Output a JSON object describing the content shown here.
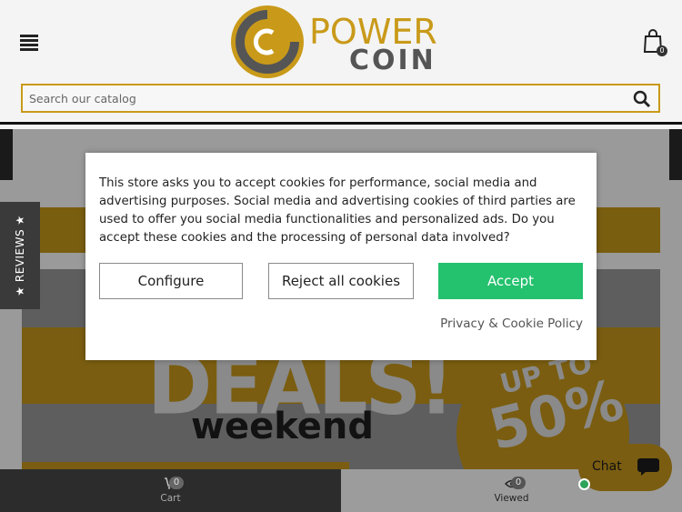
{
  "header": {
    "menu_icon": "hamburger-icon",
    "logo_text_top": "POWER",
    "logo_text_bottom": "COIN",
    "cart_icon": "shopping-bag-icon",
    "cart_count": "0"
  },
  "search": {
    "placeholder": "Search our catalog",
    "icon": "search-icon"
  },
  "reviews_tab": {
    "label": "★ REVIEWS ★"
  },
  "banner": {
    "headline": "DEALS!",
    "subline": "weekend",
    "promo_line1": "UP TO",
    "promo_line2": "50%"
  },
  "cookie_modal": {
    "message": "This store asks you to accept cookies for performance, social media and advertising purposes. Social media and advertising cookies of third parties are used to offer you social media functionalities and personalized ads. Do you accept these cookies and the processing of personal data involved?",
    "configure_label": "Configure",
    "reject_label": "Reject all cookies",
    "accept_label": "Accept",
    "policy_link": "Privacy & Cookie Policy",
    "accept_color": "#24c16e"
  },
  "bottom_bar": {
    "cart_label": "Cart",
    "cart_count": "0",
    "cart_icon": "cart-icon",
    "viewed_label": "Viewed",
    "viewed_count": "0",
    "viewed_icon": "eye-icon"
  },
  "chat": {
    "label": "Chat",
    "icon": "chat-bubble-icon",
    "status_color": "#2ea35a"
  },
  "colors": {
    "brand_gold": "#c99a1a",
    "brand_gray": "#8a8a8a"
  }
}
